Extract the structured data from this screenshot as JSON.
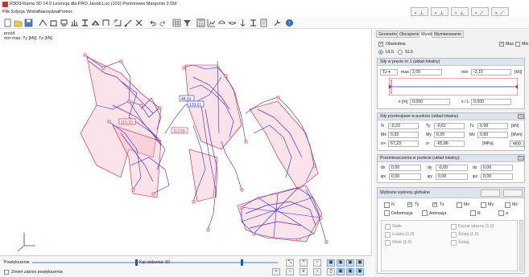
{
  "titlebar": {
    "title": "R3D3-Rama 3D 14.0 Licencja dla PRO Jacob.Luc (101) Pontonowa Margonin 2.f3d"
  },
  "menubar": {
    "items": [
      "Plik",
      "Edycja",
      "Widok",
      "Narzędzia",
      "Pomoc"
    ]
  },
  "canvas": {
    "view_name": "przód",
    "result_label": "min max: Ty [kN]; Tz [kN]",
    "value_labels": [
      "48,91",
      "133,61",
      "115,23",
      "112,65"
    ]
  },
  "bottombar": {
    "mode_label": "Powiększenie",
    "angle_label": "Kąt widzenia: 60",
    "keep_label": "Zmień zakres powiększenia"
  },
  "panel": {
    "tabs": [
      "Geometria",
      "Obciążenia",
      "Wyniki",
      "Wymiarowanie"
    ],
    "active_tab": "Wyniki",
    "envelope_label": "Obwiednia",
    "max_label": "Max",
    "min_label": "Min",
    "uls_label": "ULS",
    "sls_label": "SLS",
    "section1": {
      "title": "Siły w pręcie nr 1 (układ lokalny)",
      "component": "Tz",
      "max_label": "max",
      "max_value": "2,09",
      "min_label": "min",
      "min_value": "-2,15",
      "unit": "[kN]",
      "x_label": "x [m]",
      "x_value": "0,000",
      "xl_label": "x / L",
      "xl_value": "0,000"
    },
    "section2": {
      "title": "Siły przekrojowe w punkcie (układ lokalny)",
      "rows": [
        [
          {
            "k": "N",
            "v": "-0,23"
          },
          {
            "k": "Ty",
            "v": "-0,61"
          },
          {
            "k": "Tz",
            "v": "0,99"
          },
          {
            "k": "unit",
            "v": "[kN]"
          }
        ],
        [
          {
            "k": "Mx",
            "v": "0,33"
          },
          {
            "k": "My",
            "v": "0,20"
          },
          {
            "k": "Mz",
            "v": "0,83"
          },
          {
            "k": "unit",
            "v": "[kNm]"
          }
        ],
        [
          {
            "k": "σ+",
            "v": "67,23"
          },
          {
            "k": "σ-",
            "v": "-65,86"
          },
          {
            "k": "",
            "v": ""
          },
          {
            "k": "unit",
            "v": "[MPa]"
          }
        ]
      ],
      "button": "w(x)"
    },
    "section3": {
      "title": "Przemieszczenia w punkcie (układ lokalny)",
      "rows": [
        [
          {
            "k": "dx",
            "v": "0,00"
          },
          {
            "k": "dy",
            "v": "-0,00"
          },
          {
            "k": "dz",
            "v": "0,00"
          }
        ],
        [
          {
            "k": "φx",
            "v": "0,00"
          },
          {
            "k": "φy",
            "v": "0,00"
          },
          {
            "k": "φz",
            "v": "0,00"
          }
        ]
      ]
    },
    "section4": {
      "title": "Wybrane wykresy globalne",
      "toggles": [
        "N",
        "Ty",
        "Tz",
        "Mx",
        "My",
        "Mz"
      ],
      "toggles_checked": [
        false,
        true,
        true,
        false,
        false,
        false
      ],
      "extra": [
        "Deformacja",
        "Animacja",
        "R",
        "σ"
      ],
      "load_cases": [
        "Stałe",
        "Ciężar własny (1,0)",
        "Ludzie (1,0)",
        "Śnieg (1,0)",
        "Wiatr (1,0)",
        "Śnieg"
      ]
    }
  },
  "colors": {
    "accent": "#1a5fa8",
    "frame": "#2b2bd8",
    "diagram": "#d01a38"
  }
}
